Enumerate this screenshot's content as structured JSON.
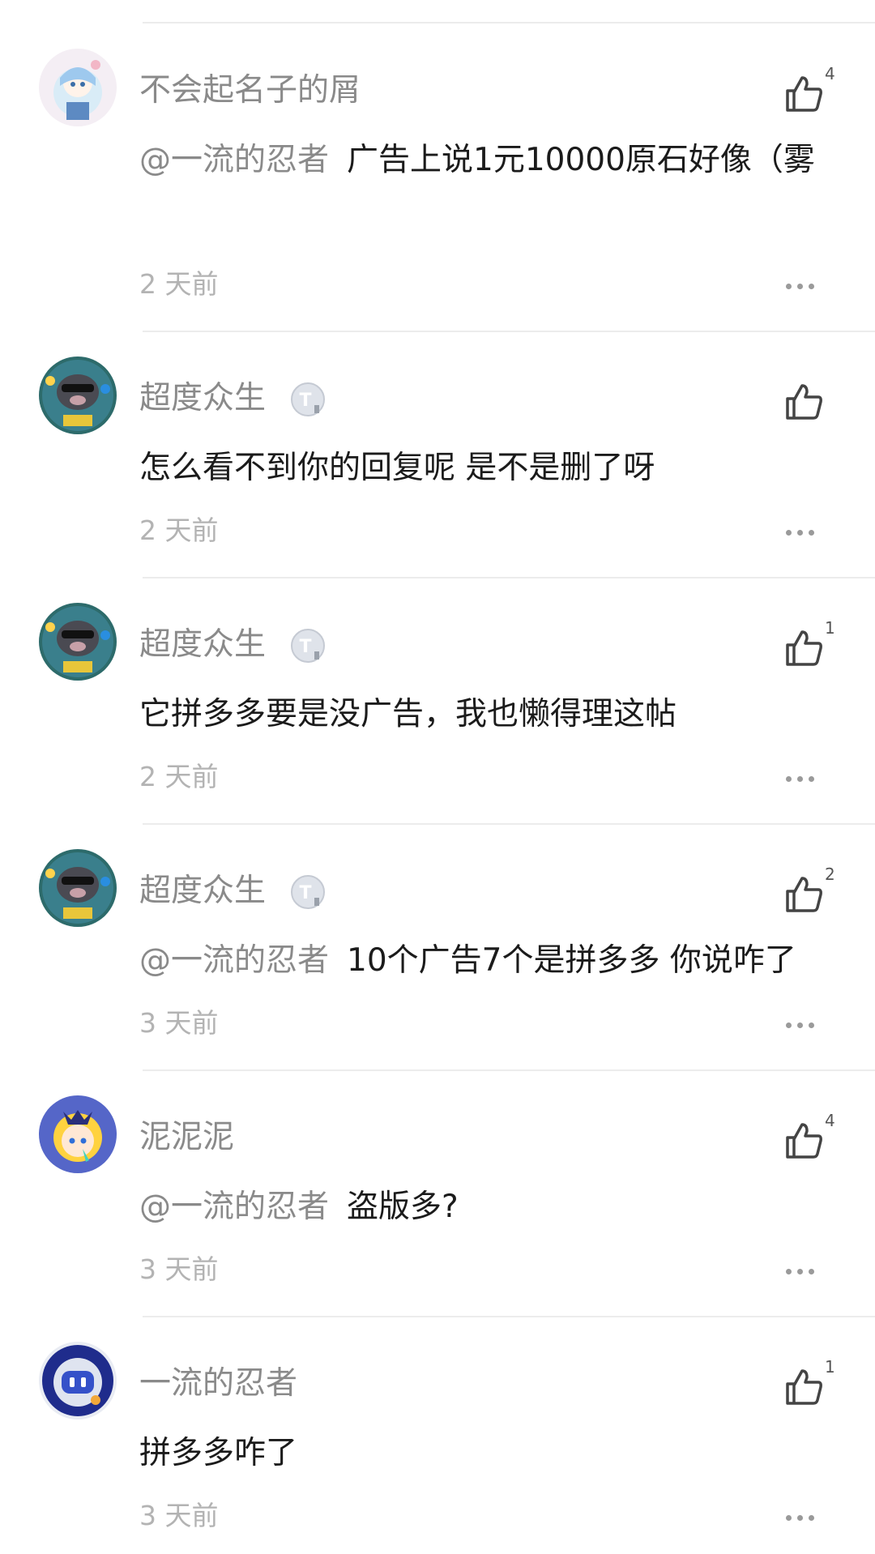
{
  "comments": [
    {
      "username": "不会起名子的屑",
      "mention": "@一流的忍者",
      "text": "广告上说1元10000原石好像（雾",
      "time": "2 天前",
      "likes": "4",
      "has_badge": false,
      "avatar": "anime-girl-avatar"
    },
    {
      "username": "超度众生",
      "mention": "",
      "text": "怎么看不到你的回复呢 是不是删了呀",
      "time": "2 天前",
      "likes": "",
      "has_badge": true,
      "avatar": "pig-avatar"
    },
    {
      "username": "超度众生",
      "mention": "",
      "text": "它拼多多要是没广告，我也懒得理这帖",
      "time": "2 天前",
      "likes": "1",
      "has_badge": true,
      "avatar": "pig-avatar"
    },
    {
      "username": "超度众生",
      "mention": "@一流的忍者",
      "text": "10个广告7个是拼多多 你说咋了",
      "time": "3 天前",
      "likes": "2",
      "has_badge": true,
      "avatar": "pig-avatar"
    },
    {
      "username": "泥泥泥",
      "mention": "@一流的忍者",
      "text": "盗版多?",
      "time": "3 天前",
      "likes": "4",
      "has_badge": false,
      "avatar": "blonde-girl-avatar"
    },
    {
      "username": "一流的忍者",
      "mention": "",
      "text": "拼多多咋了",
      "time": "3 天前",
      "likes": "1",
      "has_badge": false,
      "avatar": "robot-avatar"
    }
  ],
  "icons": {
    "like": "thumbs-up-icon",
    "more": "more-dots-icon",
    "badge": "level-badge-icon"
  },
  "colors": {
    "username": "#8a8a8a",
    "text": "#1b1b1b",
    "time": "#b3b3b3",
    "divider": "#ececec"
  }
}
